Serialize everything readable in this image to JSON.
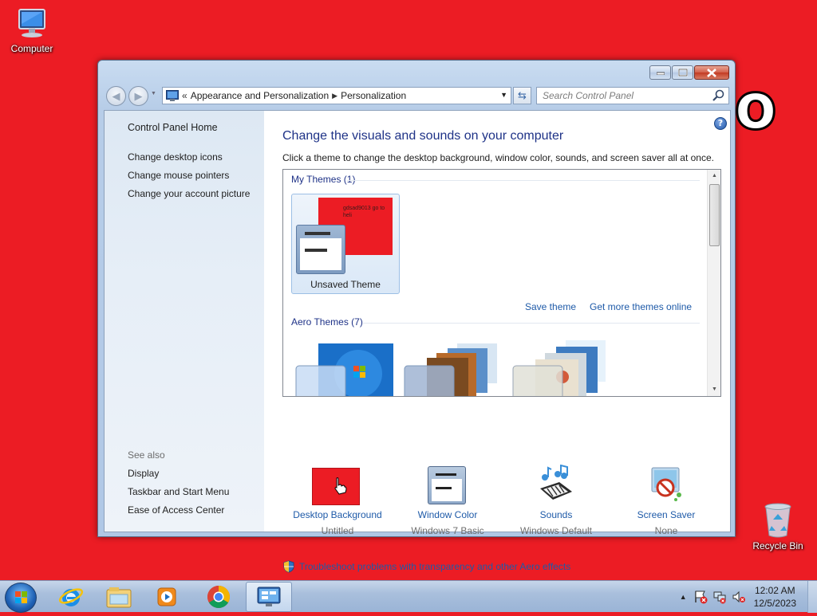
{
  "desktop": {
    "computer_label": "Computer",
    "recycle_label": "Recycle Bin",
    "big_letter": "O",
    "background_color": "#ec1c24"
  },
  "window": {
    "address": {
      "crumbs": [
        "Appearance and Personalization",
        "Personalization"
      ],
      "overflow": "«"
    },
    "search_placeholder": "Search Control Panel",
    "sidebar": {
      "home": "Control Panel Home",
      "links": [
        "Change desktop icons",
        "Change mouse pointers",
        "Change your account picture"
      ],
      "see_also_header": "See also",
      "see_also": [
        "Display",
        "Taskbar and Start Menu",
        "Ease of Access Center"
      ]
    },
    "main": {
      "title": "Change the visuals and sounds on your computer",
      "subtitle": "Click a theme to change the desktop background, window color, sounds, and screen saver all at once.",
      "my_themes_header": "My Themes (1)",
      "unsaved_theme": "Unsaved Theme",
      "unsaved_thumb_text": "gdsad9013 go to heli",
      "save_theme": "Save theme",
      "get_more_themes": "Get more themes online",
      "aero_themes_header": "Aero Themes (7)",
      "settings": [
        {
          "title": "Desktop Background",
          "value": "Untitled",
          "icon": "desktop-background-icon"
        },
        {
          "title": "Window Color",
          "value": "Windows 7 Basic",
          "icon": "window-color-icon"
        },
        {
          "title": "Sounds",
          "value": "Windows Default",
          "icon": "sounds-icon"
        },
        {
          "title": "Screen Saver",
          "value": "None",
          "icon": "screen-saver-icon"
        }
      ],
      "troubleshoot": "Troubleshoot problems with transparency and other Aero effects"
    }
  },
  "taskbar": {
    "time": "12:02 AM",
    "date": "12/5/2023",
    "pinned": [
      "internet-explorer-icon",
      "windows-explorer-icon",
      "media-player-icon",
      "chrome-icon",
      "control-panel-icon"
    ]
  },
  "colors": {
    "link": "#1e5aa8",
    "heading": "#1e3287",
    "desktop": "#ec1c24"
  }
}
